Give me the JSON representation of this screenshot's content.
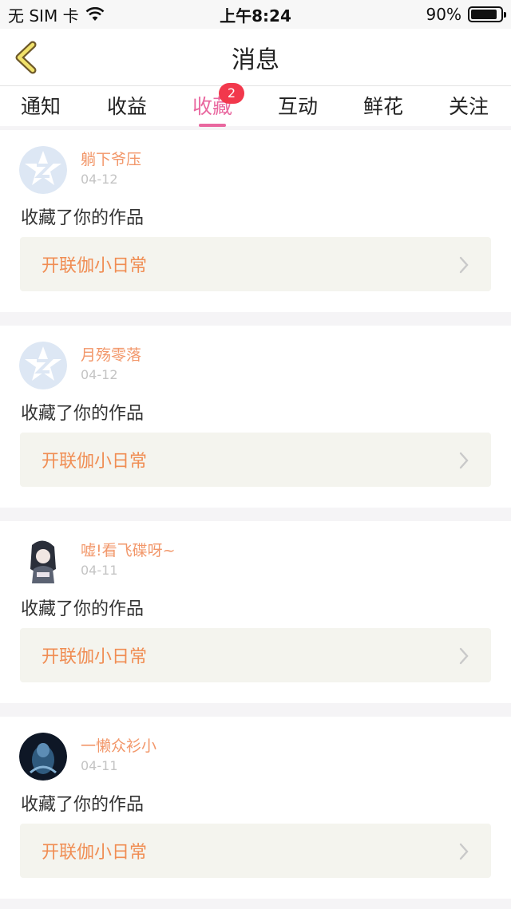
{
  "status_bar": {
    "carrier": "无 SIM 卡",
    "time": "上午8:24",
    "battery": "90%",
    "battery_level": 0.9
  },
  "nav": {
    "title": "消息",
    "back_icon": "back-chevron-icon",
    "accent_color": "#e9679f"
  },
  "tabs": [
    {
      "label": "通知"
    },
    {
      "label": "收益"
    },
    {
      "label": "收藏",
      "active": true,
      "badge": "2"
    },
    {
      "label": "互动"
    },
    {
      "label": "鲜花"
    },
    {
      "label": "关注"
    }
  ],
  "items": [
    {
      "user": "躺下爷压",
      "date": "04-12",
      "action": "收藏了你的作品",
      "work": "开联伽小日常",
      "avatar": "default-qq-avatar"
    },
    {
      "user": "月殇零落",
      "date": "04-12",
      "action": "收藏了你的作品",
      "work": "开联伽小日常",
      "avatar": "default-qq-avatar"
    },
    {
      "user": "嘘!看飞碟呀~",
      "date": "04-11",
      "action": "收藏了你的作品",
      "work": "开联伽小日常",
      "avatar": "anime-girl-avatar"
    },
    {
      "user": "一懒众衫小",
      "date": "04-11",
      "action": "收藏了你的作品",
      "work": "开联伽小日常",
      "avatar": "dark-photo-avatar"
    }
  ]
}
